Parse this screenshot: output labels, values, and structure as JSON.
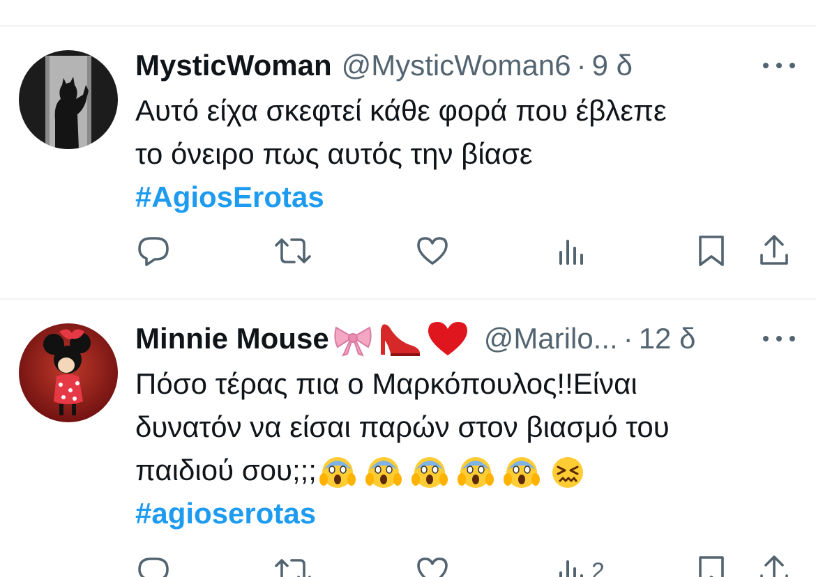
{
  "tweets": [
    {
      "author_name": "MysticWoman",
      "handle": "@MysticWoman6",
      "separator": "·",
      "time": "9 δ",
      "text_lines": [
        "Αυτό είχα σκεφτεί κάθε φορά που έβλεπε",
        "το όνειρο πως αυτός την βίασε"
      ],
      "hashtag": "#AgiosErotas",
      "views_count": "",
      "avatar_icon": "shadow-silhouette-avatar"
    },
    {
      "author_name": "Minnie Mouse",
      "name_emojis": [
        "ribbon-emoji",
        "high-heel-emoji",
        "red-heart-emoji"
      ],
      "handle": "@Marilo...",
      "separator": "·",
      "time": "12 δ",
      "text_lines": [
        "Πόσο τέρας πια ο Μαρκόπουλος!!Είναι",
        "δυνατόν να είσαι παρών στον βιασμό του",
        "παιδιού σου;;;"
      ],
      "text_emojis": [
        "scream-emoji",
        "scream-emoji",
        "scream-emoji",
        "scream-emoji",
        "scream-emoji",
        "confounded-emoji"
      ],
      "hashtag": "#agioserotas",
      "views_count": "2",
      "avatar_icon": "minnie-mouse-avatar"
    }
  ],
  "icons": [
    "reply-icon",
    "retweet-icon",
    "like-icon",
    "views-icon",
    "bookmark-icon",
    "share-icon",
    "more-icon"
  ],
  "colors": {
    "text": "#0f1419",
    "secondary": "#536471",
    "link": "#1d9bf0",
    "divider": "#eff3f4"
  }
}
